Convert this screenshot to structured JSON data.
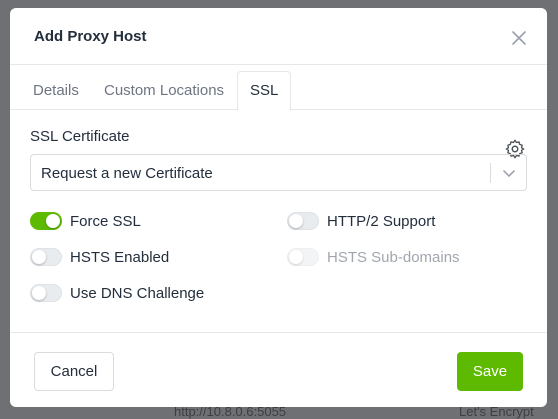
{
  "background": {
    "url_fragment": "http://10.8.0.6:5055",
    "ssl_fragment": "Let's Encrypt"
  },
  "modal": {
    "title": "Add Proxy Host",
    "close_icon": "close-icon",
    "tabs": [
      {
        "label": "Details",
        "active": false
      },
      {
        "label": "Custom Locations",
        "active": false
      },
      {
        "label": "SSL",
        "active": true
      }
    ],
    "settings_icon": "gear-icon",
    "ssl": {
      "certificate_label": "SSL Certificate",
      "certificate_value": "Request a new Certificate",
      "options": [
        {
          "label": "Force SSL",
          "enabled": true,
          "disabled": false
        },
        {
          "label": "HTTP/2 Support",
          "enabled": false,
          "disabled": false
        },
        {
          "label": "HSTS Enabled",
          "enabled": false,
          "disabled": false
        },
        {
          "label": "HSTS Sub-domains",
          "enabled": false,
          "disabled": true
        },
        {
          "label": "Use DNS Challenge",
          "enabled": false,
          "disabled": false
        }
      ]
    },
    "footer": {
      "cancel_label": "Cancel",
      "save_label": "Save"
    }
  },
  "colors": {
    "accent": "#5eba00",
    "text": "#232e3c",
    "muted": "#a1a6ae"
  }
}
